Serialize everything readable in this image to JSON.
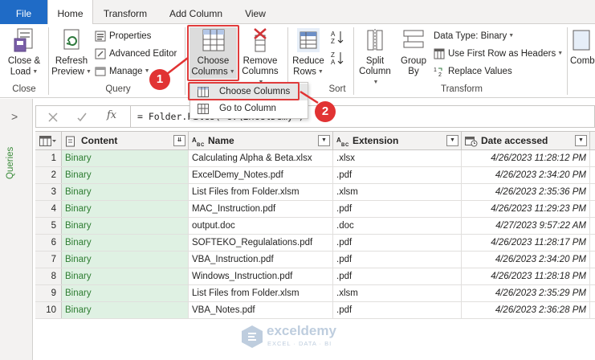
{
  "tabs": [
    {
      "label": "File"
    },
    {
      "label": "Home"
    },
    {
      "label": "Transform"
    },
    {
      "label": "Add Column"
    },
    {
      "label": "View"
    }
  ],
  "ribbon": {
    "close": {
      "line1": "Close &",
      "line2": "Load",
      "group": "Close"
    },
    "query": {
      "refresh_line1": "Refresh",
      "refresh_line2": "Preview",
      "properties": "Properties",
      "advanced_editor": "Advanced Editor",
      "manage": "Manage",
      "group": "Query"
    },
    "manage_columns": {
      "choose_line1": "Choose",
      "choose_line2": "Columns",
      "remove_line1": "Remove",
      "remove_line2": "Columns"
    },
    "reduce": {
      "line1": "Reduce",
      "line2": "Rows"
    },
    "sort": {
      "group": "Sort"
    },
    "transform": {
      "split_line1": "Split",
      "split_line2": "Column",
      "group_line1": "Group",
      "group_line2": "By",
      "data_type": "Data Type: Binary",
      "first_row": "Use First Row as Headers",
      "replace": "Replace Values",
      "group": "Transform"
    },
    "combine": {
      "label": "Comb"
    }
  },
  "menu": {
    "items": [
      {
        "label": "Choose Columns"
      },
      {
        "label": "Go to Column"
      }
    ]
  },
  "markers": {
    "one": "1",
    "two": "2"
  },
  "queries_pane": {
    "label": "Queries"
  },
  "formula_bar": {
    "fx": "fx",
    "formula": "= Folder.Files(\"C:\\ExcelDemy\")"
  },
  "table": {
    "columns": [
      {
        "name": "Content"
      },
      {
        "name": "Name"
      },
      {
        "name": "Extension"
      },
      {
        "name": "Date accessed"
      }
    ],
    "rows": [
      {
        "idx": "1",
        "content": "Binary",
        "name": "Calculating Alpha & Beta.xlsx",
        "ext": ".xlsx",
        "date": "4/26/2023 11:28:12 PM"
      },
      {
        "idx": "2",
        "content": "Binary",
        "name": "ExcelDemy_Notes.pdf",
        "ext": ".pdf",
        "date": "4/26/2023 2:34:20 PM"
      },
      {
        "idx": "3",
        "content": "Binary",
        "name": "List Files from Folder.xlsm",
        "ext": ".xlsm",
        "date": "4/26/2023 2:35:36 PM"
      },
      {
        "idx": "4",
        "content": "Binary",
        "name": "MAC_Instruction.pdf",
        "ext": ".pdf",
        "date": "4/26/2023 11:29:23 PM"
      },
      {
        "idx": "5",
        "content": "Binary",
        "name": "output.doc",
        "ext": ".doc",
        "date": "4/27/2023 9:57:22 AM"
      },
      {
        "idx": "6",
        "content": "Binary",
        "name": "SOFTEKO_Regulalations.pdf",
        "ext": ".pdf",
        "date": "4/26/2023 11:28:17 PM"
      },
      {
        "idx": "7",
        "content": "Binary",
        "name": "VBA_Instruction.pdf",
        "ext": ".pdf",
        "date": "4/26/2023 2:34:20 PM"
      },
      {
        "idx": "8",
        "content": "Binary",
        "name": "Windows_Instruction.pdf",
        "ext": ".pdf",
        "date": "4/26/2023 11:28:18 PM"
      },
      {
        "idx": "9",
        "content": "Binary",
        "name": "List Files from Folder.xlsm",
        "ext": ".xlsm",
        "date": "4/26/2023 2:35:29 PM"
      },
      {
        "idx": "10",
        "content": "Binary",
        "name": "VBA_Notes.pdf",
        "ext": ".pdf",
        "date": "4/26/2023 2:36:28 PM"
      }
    ]
  },
  "watermark": {
    "name": "exceldemy",
    "tag": "EXCEL · DATA · BI"
  },
  "colors": {
    "file_tab": "#1f6bc6",
    "marker": "#e13333",
    "content_col": "#dff1e3",
    "binary_text": "#2e7d32"
  }
}
